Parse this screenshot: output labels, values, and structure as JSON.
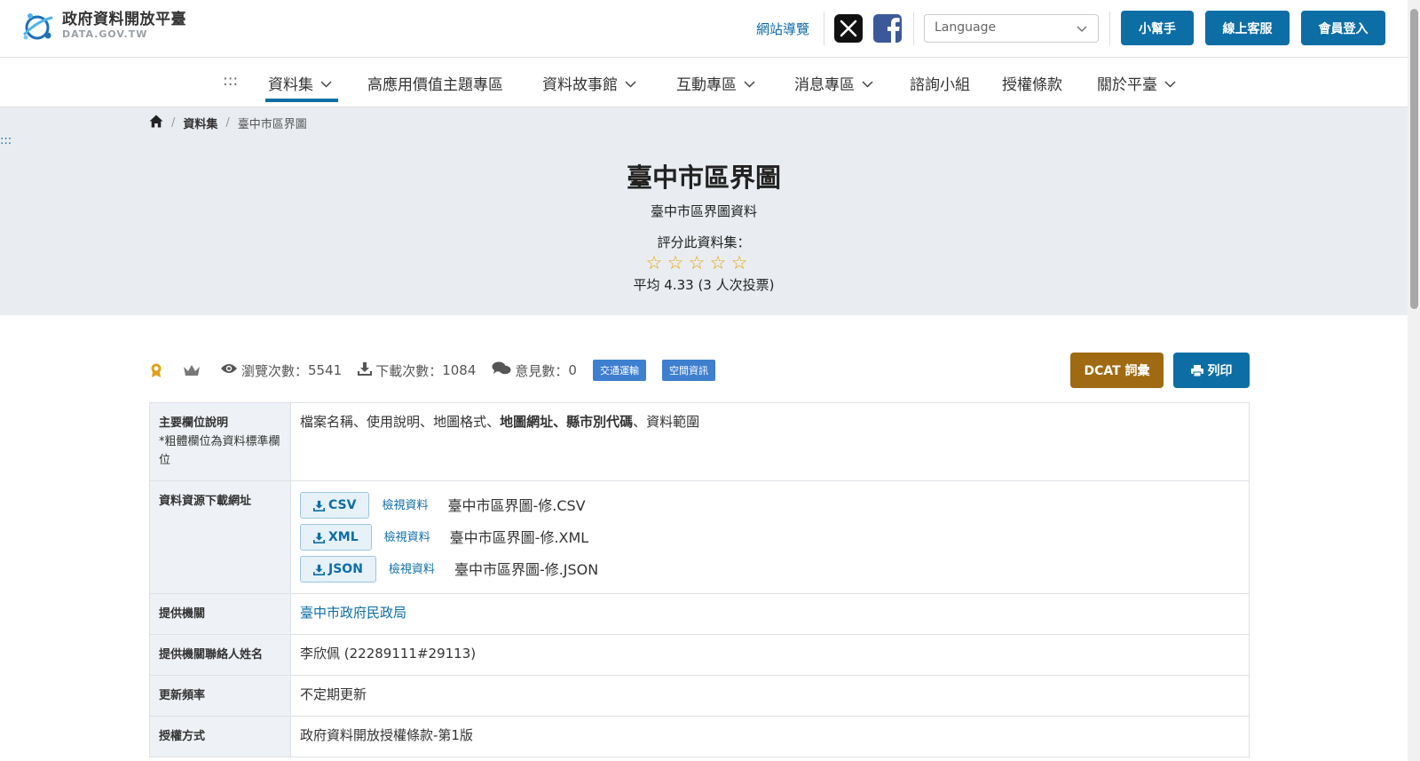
{
  "header": {
    "logo_title": "政府資料開放平臺",
    "logo_sub": "DATA.GOV.TW",
    "sitemap": "網站導覽",
    "language_placeholder": "Language",
    "buttons": {
      "helper": "小幫手",
      "support": "線上客服",
      "login": "會員登入"
    }
  },
  "nav": {
    "skip": ":::",
    "items": [
      {
        "label": "資料集",
        "dropdown": true,
        "active": true
      },
      {
        "label": "高應用價值主題專區",
        "dropdown": false
      },
      {
        "label": "資料故事館",
        "dropdown": true
      },
      {
        "label": "互動專區",
        "dropdown": true
      },
      {
        "label": "消息專區",
        "dropdown": true
      },
      {
        "label": "諮詢小組",
        "dropdown": false
      },
      {
        "label": "授權條款",
        "dropdown": false
      },
      {
        "label": "關於平臺",
        "dropdown": true
      }
    ]
  },
  "breadcrumb": {
    "section": "資料集",
    "current": "臺中市區界圖"
  },
  "skip_anchor": ":::",
  "dataset": {
    "title": "臺中市區界圖",
    "subtitle": "臺中市區界圖資料",
    "rate_label": "評分此資料集：",
    "stars_filled": 0,
    "stars_total": 5,
    "average": "平均 4.33 (3 人次投票)"
  },
  "stats": {
    "views_label": "瀏覽次數：",
    "views": "5541",
    "downloads_label": "下載次數：",
    "downloads": "1084",
    "comments_label": "意見數：",
    "comments": "0",
    "tags": [
      "交通運輸",
      "空間資訊"
    ],
    "dcat_button": "DCAT 詞彙",
    "print_button": "列印"
  },
  "table": {
    "fields_key": "主要欄位說明",
    "fields_note": "*粗體欄位為資料標準欄位",
    "fields": [
      {
        "text": "檔案名稱",
        "bold": false
      },
      {
        "text": "使用說明",
        "bold": false
      },
      {
        "text": "地圖格式",
        "bold": false
      },
      {
        "text": "地圖網址",
        "bold": true
      },
      {
        "text": "縣市別代碼",
        "bold": true
      },
      {
        "text": "資料範圍",
        "bold": false
      }
    ],
    "resources_key": "資料資源下載網址",
    "resources": [
      {
        "format": "CSV",
        "view": "檢視資料",
        "name": "臺中市區界圖-修.CSV"
      },
      {
        "format": "XML",
        "view": "檢視資料",
        "name": "臺中市區界圖-修.XML"
      },
      {
        "format": "JSON",
        "view": "檢視資料",
        "name": "臺中市區界圖-修.JSON"
      }
    ],
    "org_key": "提供機關",
    "org_value": "臺中市政府民政局",
    "contact_key": "提供機關聯絡人姓名",
    "contact_value": "李欣佩 (22289111#29113)",
    "freq_key": "更新頻率",
    "freq_value": "不定期更新",
    "license_key": "授權方式",
    "license_value": "政府資料開放授權條款-第1版"
  }
}
